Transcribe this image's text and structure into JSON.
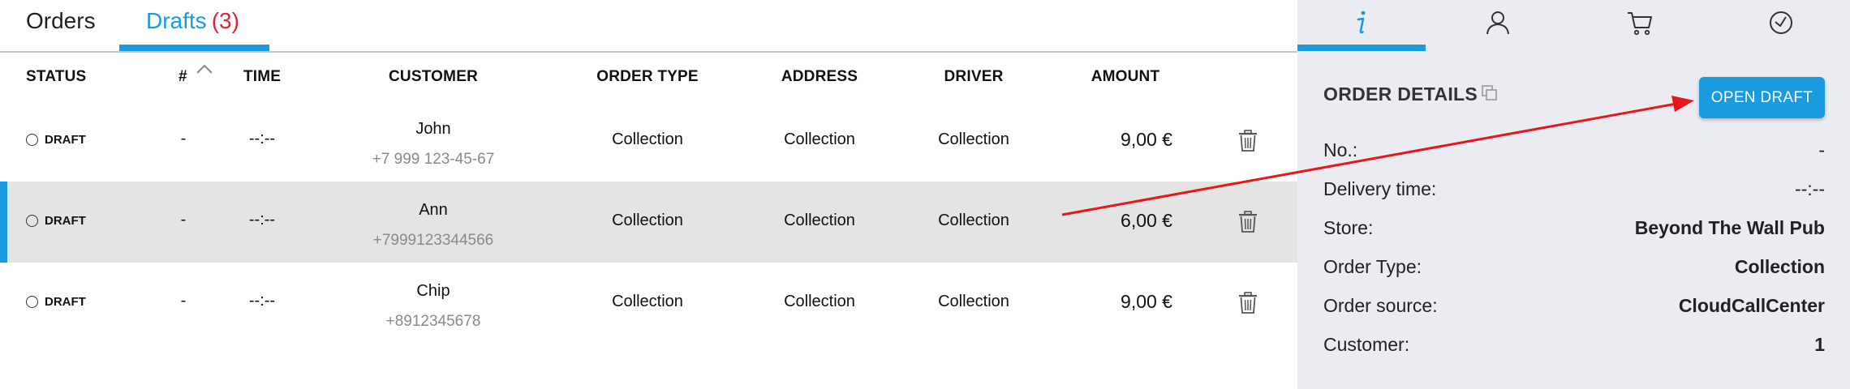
{
  "tabs": {
    "orders_label": "Orders",
    "drafts_label": "Drafts",
    "drafts_count": "(3)"
  },
  "table": {
    "headers": {
      "status": "STATUS",
      "number": "#",
      "time": "TIME",
      "customer": "CUSTOMER",
      "order_type": "ORDER TYPE",
      "address": "ADDRESS",
      "driver": "DRIVER",
      "amount": "AMOUNT"
    },
    "rows": [
      {
        "status": "DRAFT",
        "number": "-",
        "time": "--:--",
        "customer_name": "John",
        "customer_phone": "+7 999 123-45-67",
        "order_type": "Collection",
        "address": "Collection",
        "driver": "Collection",
        "amount": "9,00 €"
      },
      {
        "status": "DRAFT",
        "number": "-",
        "time": "--:--",
        "customer_name": "Ann",
        "customer_phone": "+7999123344566",
        "order_type": "Collection",
        "address": "Collection",
        "driver": "Collection",
        "amount": "6,00 €"
      },
      {
        "status": "DRAFT",
        "number": "-",
        "time": "--:--",
        "customer_name": "Chip",
        "customer_phone": "+8912345678",
        "order_type": "Collection",
        "address": "Collection",
        "driver": "Collection",
        "amount": "9,00 €"
      }
    ],
    "selected_row_index": 1
  },
  "right_panel": {
    "tab_icons": [
      "info-icon",
      "user-icon",
      "cart-icon",
      "clock-icon"
    ],
    "title": "ORDER DETAILS",
    "open_draft_label": "OPEN DRAFT",
    "details": [
      {
        "key": "No.:",
        "value": "-"
      },
      {
        "key": "Delivery time:",
        "value": "--:--"
      },
      {
        "key": "Store:",
        "value": "Beyond The Wall Pub"
      },
      {
        "key": "Order Type:",
        "value": "Collection"
      },
      {
        "key": "Order source:",
        "value": "CloudCallCenter"
      },
      {
        "key": "Customer:",
        "value": "1"
      }
    ]
  },
  "colors": {
    "accent": "#1a9be0",
    "count_red": "#e0243c",
    "annotation_arrow": "#e8161b",
    "selected_row": "#e4e4e4",
    "panel_bg": "#eaecf1"
  }
}
